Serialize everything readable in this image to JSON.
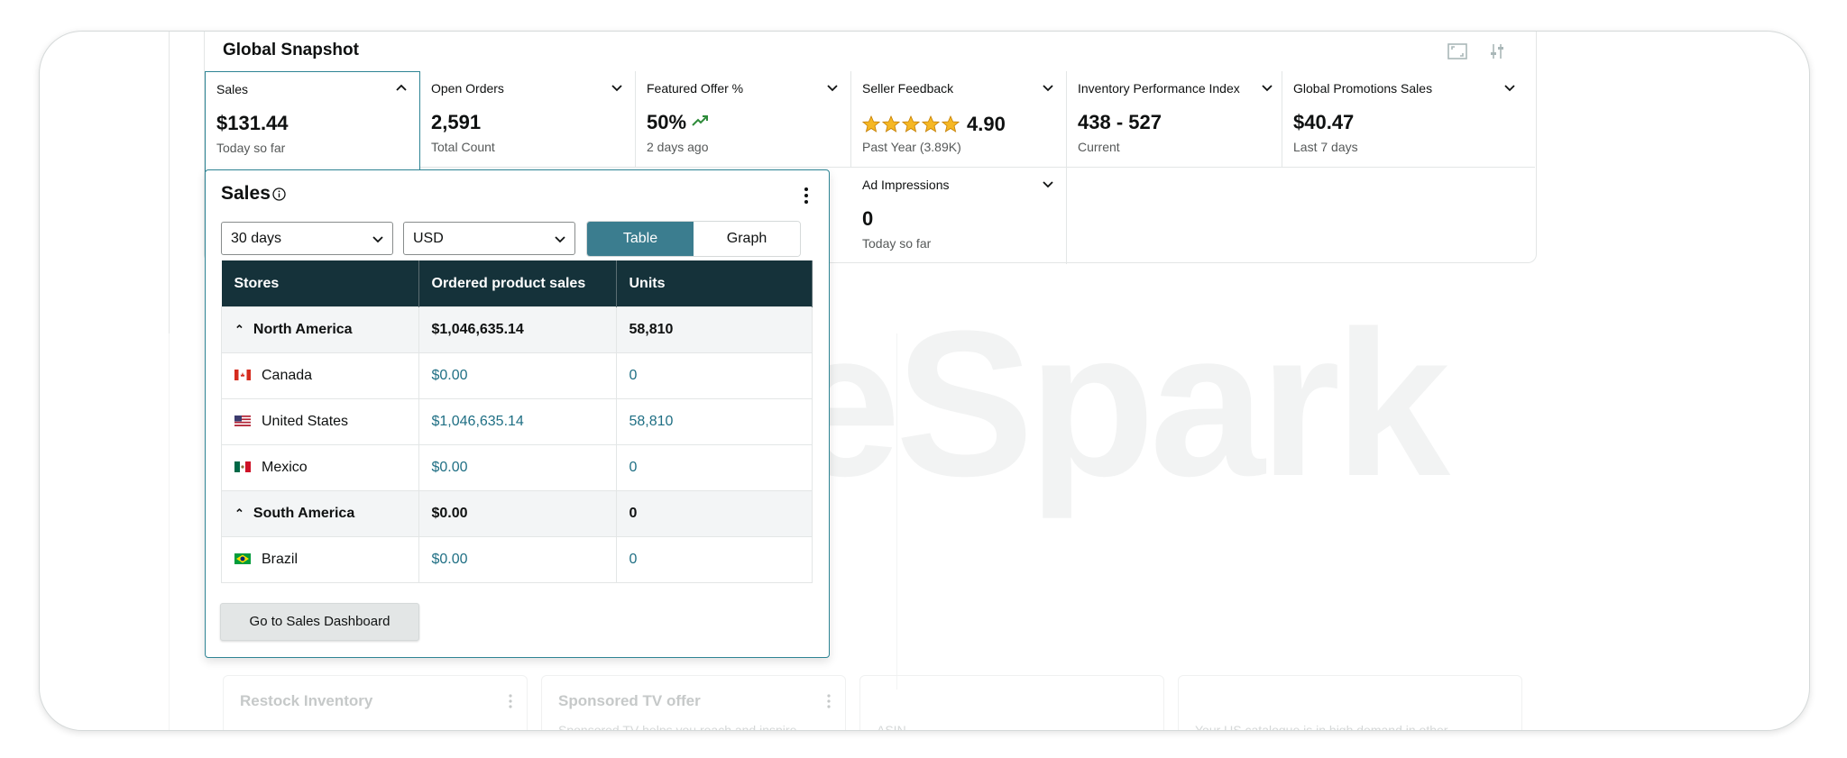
{
  "snapshot": {
    "title": "Global Snapshot",
    "metrics": [
      {
        "label": "Sales",
        "value": "$131.44",
        "sub": "Today so far"
      },
      {
        "label": "Open Orders",
        "value": "2,591",
        "sub": "Total Count"
      },
      {
        "label": "Featured Offer %",
        "value": "50%",
        "sub": "2 days ago"
      },
      {
        "label": "Seller Feedback",
        "value": "4.90",
        "sub": "Past Year (3.89K)"
      },
      {
        "label": "Inventory Performance Index",
        "value": "438 - 527",
        "sub": "Current"
      },
      {
        "label": "Global Promotions Sales",
        "value": "$40.47",
        "sub": "Last 7 days"
      },
      {
        "label": "Ad Impressions",
        "value": "0",
        "sub": "Today so far"
      }
    ],
    "icons": [
      "expand-icon",
      "settings-sliders-icon"
    ],
    "seller_feedback_stars": 5
  },
  "popup": {
    "title": "Sales",
    "period": "30 days",
    "currency": "USD",
    "view_table": "Table",
    "view_graph": "Graph",
    "columns": [
      "Stores",
      "Ordered product sales",
      "Units"
    ],
    "rows": [
      {
        "name": "North America",
        "sales": "$1,046,635.14",
        "units": "58,810"
      },
      {
        "name": "Canada",
        "sales": "$0.00",
        "units": "0"
      },
      {
        "name": "United States",
        "sales": "$1,046,635.14",
        "units": "58,810"
      },
      {
        "name": "Mexico",
        "sales": "$0.00",
        "units": "0"
      },
      {
        "name": "South America",
        "sales": "$0.00",
        "units": "0"
      },
      {
        "name": "Brazil",
        "sales": "$0.00",
        "units": "0"
      }
    ],
    "dashboard_button": "Go to Sales Dashboard"
  },
  "watermark": "WeSpark",
  "background_cards": [
    {
      "title": "Restock Inventory"
    },
    {
      "title": "Sponsored TV offer",
      "text": "Sponsored TV helps you reach and inspire"
    },
    {
      "text": "ASIN"
    },
    {
      "text": "Your US catalogue is in high demand in other"
    }
  ],
  "colors": {
    "accent": "#2e8494",
    "table_header": "#15323a",
    "link": "#1f6f84",
    "toggle_on": "#3b7d8f"
  }
}
